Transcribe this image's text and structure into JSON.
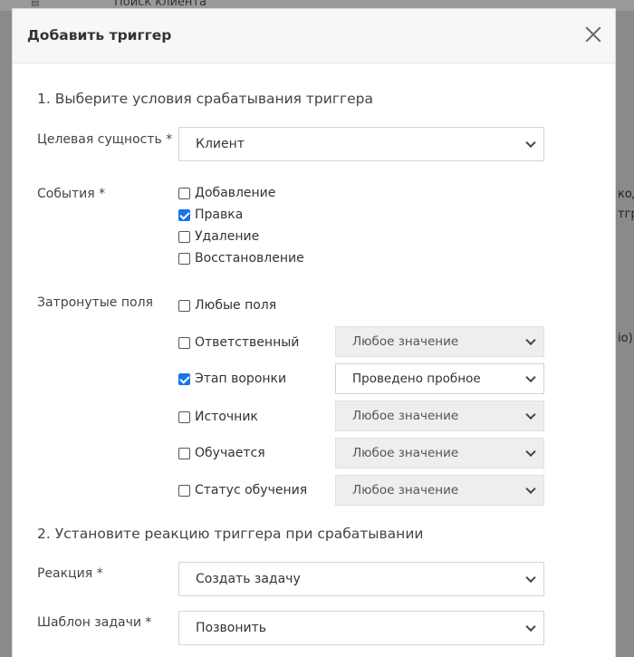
{
  "background": {
    "search_placeholder": "Поиск клиента",
    "right_text_1": "код",
    "right_text_2": "тгр",
    "right_text_3": "io)"
  },
  "modal": {
    "title": "Добавить триггер",
    "section1_title": "1. Выберите условия срабатывания триггера",
    "target_entity": {
      "label": "Целевая сущность *",
      "value": "Клиент"
    },
    "events": {
      "label": "События *",
      "items": [
        {
          "label": "Добавление",
          "checked": false
        },
        {
          "label": "Правка",
          "checked": true
        },
        {
          "label": "Удаление",
          "checked": false
        },
        {
          "label": "Восстановление",
          "checked": false
        }
      ]
    },
    "affected_fields": {
      "label": "Затронутые поля",
      "any_fields": {
        "label": "Любые поля",
        "checked": false
      },
      "fields": [
        {
          "label": "Ответственный",
          "checked": false,
          "value": "Любое значение",
          "enabled": false
        },
        {
          "label": "Этап воронки",
          "checked": true,
          "value": "Проведено пробное",
          "enabled": true
        },
        {
          "label": "Источник",
          "checked": false,
          "value": "Любое значение",
          "enabled": false
        },
        {
          "label": "Обучается",
          "checked": false,
          "value": "Любое значение",
          "enabled": false
        },
        {
          "label": "Статус обучения",
          "checked": false,
          "value": "Любое значение",
          "enabled": false
        }
      ]
    },
    "section2_title": "2. Установите реакцию триггера при срабатывании",
    "reaction": {
      "label": "Реакция *",
      "value": "Создать задачу"
    },
    "task_template": {
      "label": "Шаблон задачи *",
      "value": "Позвонить"
    }
  },
  "colors": {
    "checkbox_accent": "#1a73e8",
    "header_bg": "#f7f7f7",
    "disabled_select_bg": "#eeeeee"
  }
}
